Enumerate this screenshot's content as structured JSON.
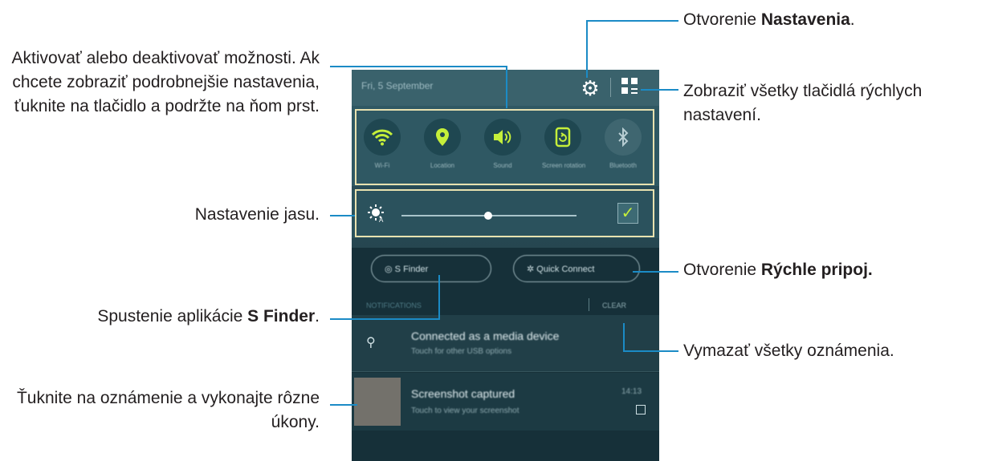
{
  "annotations": {
    "toggle_options": "Aktivovať alebo deaktivovať možnosti. Ak chcete zobraziť podrobnejšie nastavenia, ťuknite na tlačidlo a podržte na ňom prst.",
    "brightness": "Nastavenie jasu.",
    "s_finder_prefix": "Spustenie aplikácie ",
    "s_finder_bold": "S Finder",
    "s_finder_suffix": ".",
    "tap_notification": "Ťuknite na oznámenie a vykonajte rôzne úkony.",
    "open_settings_prefix": "Otvorenie ",
    "open_settings_bold": "Nastavenia",
    "open_settings_suffix": ".",
    "show_all_quick": "Zobraziť všetky tlačidlá rýchlych nastavení.",
    "quick_connect_prefix": "Otvorenie ",
    "quick_connect_bold": "Rýchle pripoj.",
    "clear_all": "Vymazať všetky oznámenia."
  },
  "phone": {
    "date": "Fri, 5 September",
    "tiles": [
      {
        "label": "Wi-Fi",
        "icon": "wifi-icon",
        "active": true
      },
      {
        "label": "Location",
        "icon": "location-icon",
        "active": true
      },
      {
        "label": "Sound",
        "icon": "sound-icon",
        "active": true
      },
      {
        "label": "Screen rotation",
        "icon": "rotation-icon",
        "active": true
      },
      {
        "label": "Bluetooth",
        "icon": "bluetooth-icon",
        "active": false
      }
    ],
    "brightness_auto": "Auto",
    "s_finder": "S Finder",
    "quick_connect": "Quick Connect",
    "notifications_header": "NOTIFICATIONS",
    "clear": "CLEAR",
    "notif1_title": "Connected as a media device",
    "notif1_sub": "Touch for other USB options",
    "notif2_title": "Screenshot captured",
    "notif2_sub": "Touch to view your screenshot",
    "notif2_time": "14:13"
  },
  "colors": {
    "callout_line": "#1b8bc6",
    "highlight_border": "#e9e2b0",
    "active_icon": "#c5ef3a"
  }
}
